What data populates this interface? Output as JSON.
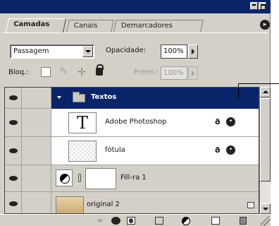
{
  "tabs": [
    {
      "label": "Camadas",
      "active": true
    },
    {
      "label": "Canais",
      "active": false
    },
    {
      "label": "Demarcadores",
      "active": false
    }
  ],
  "toolbar": {
    "blend_mode": "Passagem",
    "opacity_label": "Opacidade:",
    "opacity_value": "100%",
    "lock_label": "Bloq.:",
    "fill_label": "Preen.:",
    "fill_value": "100%"
  },
  "layers": {
    "group_name": "Textos",
    "text_layer_name": "Adobe Photoshop",
    "text_thumb_glyph": "T",
    "blur_layer_name": "fótula",
    "fill_layer_name": "Fill-ra 1",
    "copy_layer_name": "original 2",
    "fx_symbol": "ð"
  },
  "colors": {
    "selection": "#0a246a",
    "panel_bg": "#d4d0c8"
  }
}
